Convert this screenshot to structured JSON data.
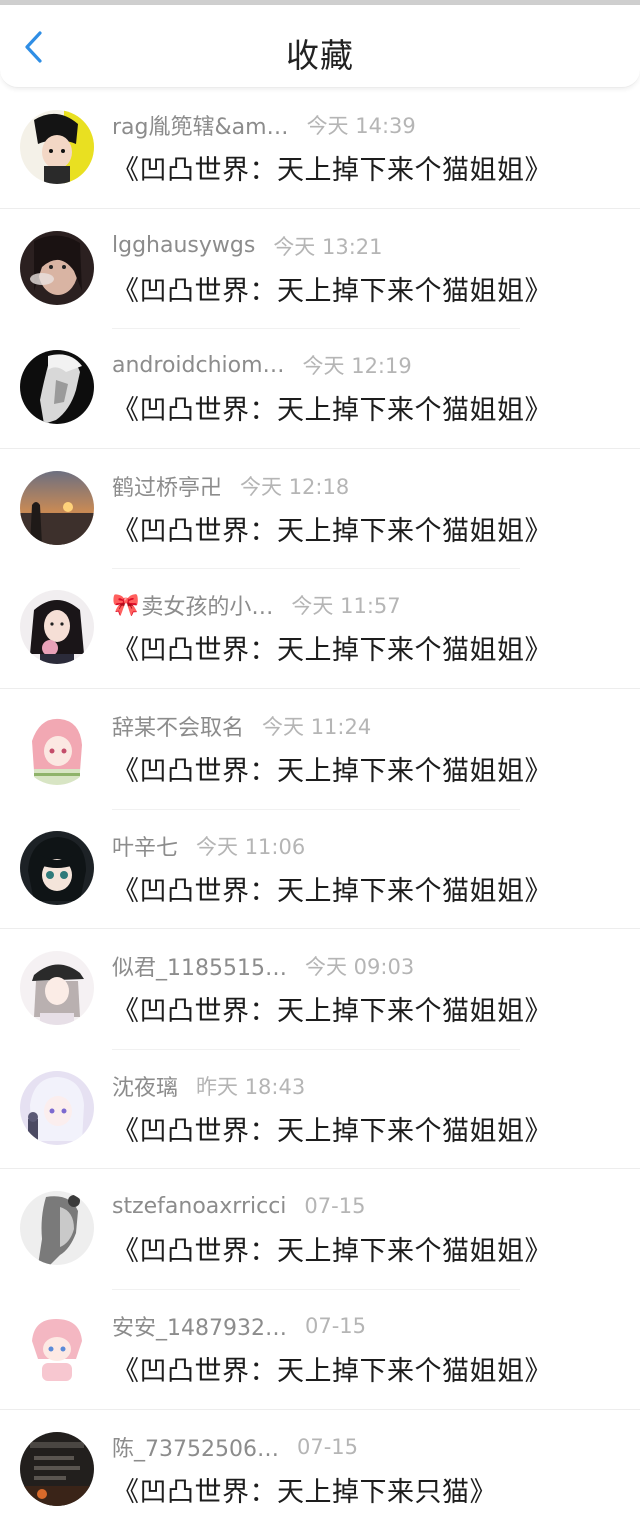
{
  "header": {
    "title": "收藏"
  },
  "items": [
    {
      "name": "rag胤篼辖&am…",
      "time": "今天 14:39",
      "title": "《凹凸世界：天上掉下来个猫姐姐》",
      "avatar": "avatar-manga-boy"
    },
    {
      "name": "lgghausywgs",
      "time": "今天 13:21",
      "title": "《凹凸世界：天上掉下来个猫姐姐》",
      "avatar": "avatar-woman-smoke"
    },
    {
      "name": "androidchiom…",
      "time": "今天 12:19",
      "title": "《凹凸世界：天上掉下来个猫姐姐》",
      "avatar": "avatar-man-dark"
    },
    {
      "name": "鹤过桥亭卍",
      "time": "今天 12:18",
      "title": "《凹凸世界：天上掉下来个猫姐姐》",
      "avatar": "avatar-sunset"
    },
    {
      "name": "卖女孩的小…",
      "time": "今天 11:57",
      "title": "《凹凸世界：天上掉下来个猫姐姐》",
      "avatar": "avatar-girl-photo",
      "prefix_icon": "🎀"
    },
    {
      "name": "辞某不会取名",
      "time": "今天 11:24",
      "title": "《凹凸世界：天上掉下来个猫姐姐》",
      "avatar": "avatar-anime-pink"
    },
    {
      "name": "叶辛七",
      "time": "今天 11:06",
      "title": "《凹凸世界：天上掉下来个猫姐姐》",
      "avatar": "avatar-anime-dark"
    },
    {
      "name": "似君_1185515…",
      "time": "今天 09:03",
      "title": "《凹凸世界：天上掉下来个猫姐姐》",
      "avatar": "avatar-girl-cap"
    },
    {
      "name": "沈夜璃",
      "time": "昨天 18:43",
      "title": "《凹凸世界：天上掉下来个猫姐姐》",
      "avatar": "avatar-anime-lilac"
    },
    {
      "name": "stzefanoaxrricci",
      "time": "07-15",
      "title": "《凹凸世界：天上掉下来个猫姐姐》",
      "avatar": "avatar-gray-profile"
    },
    {
      "name": "安安_1487932…",
      "time": "07-15",
      "title": "《凹凸世界：天上掉下来个猫姐姐》",
      "avatar": "avatar-chibi-pink"
    },
    {
      "name": "陈_73752506…",
      "time": "07-15",
      "title": "《凹凸世界：天上掉下来只猫》",
      "avatar": "avatar-dark-screen"
    }
  ],
  "colors": {
    "accent": "#2f8ee5",
    "name_text": "#8c8c8c",
    "time_text": "#b5b5b5",
    "title_text": "#1d1d1d"
  }
}
